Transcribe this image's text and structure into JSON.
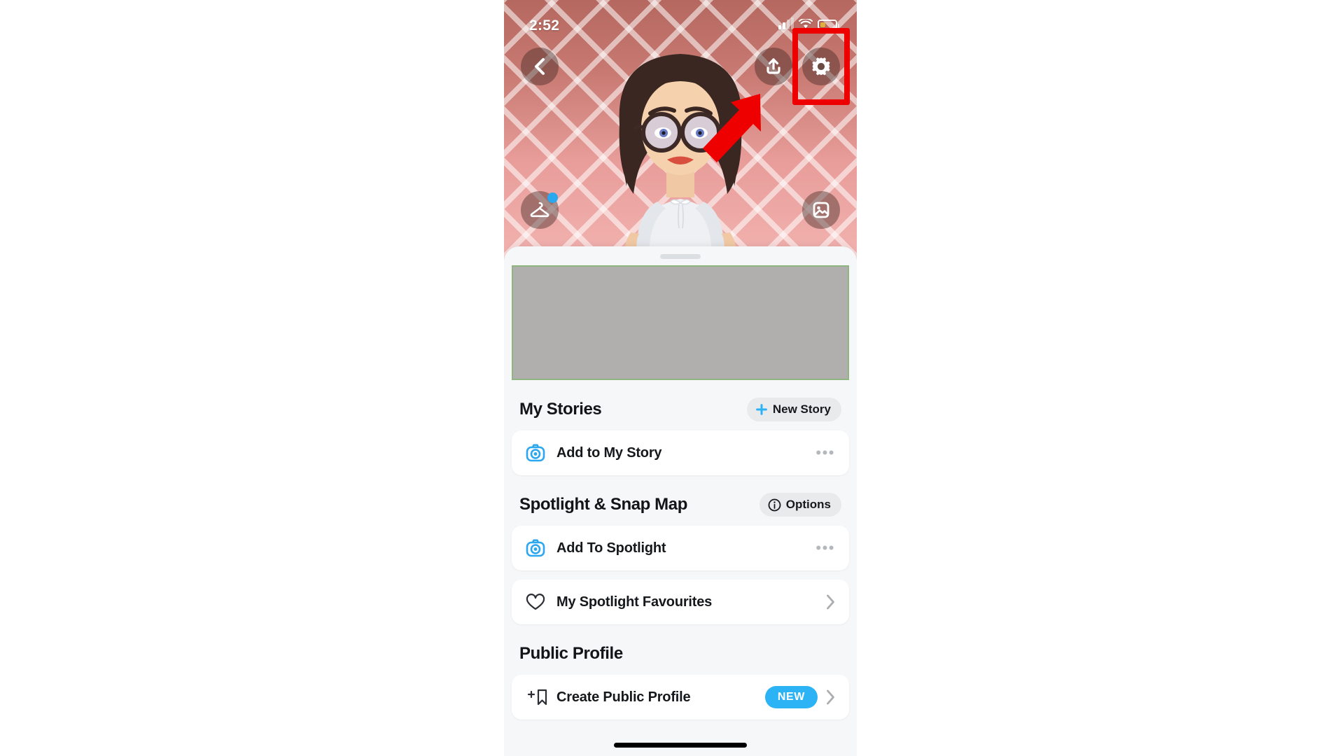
{
  "status_bar": {
    "time": "2:52",
    "signal_icon": "cellular-signal-icon",
    "wifi_icon": "wifi-icon",
    "battery_icon": "battery-icon"
  },
  "hero": {
    "back_icon": "chevron-left-icon",
    "share_icon": "share-upload-icon",
    "settings_icon": "gear-icon",
    "wardrobe_icon": "clothes-hanger-icon",
    "memories_icon": "photo-image-icon",
    "avatar_alt": "bitmoji-avatar",
    "annotation_box_color": "#ee0000",
    "annotation_arrow_color": "#ee0000",
    "badge_color": "#29a8f0",
    "background_color": "#c87a72"
  },
  "sheet": {
    "redacted_block": "",
    "sections": [
      {
        "title": "My Stories",
        "action": {
          "label": "New Story",
          "icon": "plus-icon"
        },
        "rows": [
          {
            "label": "Add to My Story",
            "icon": "camera-icon",
            "trailing": "more-options",
            "trailing_text": "•••"
          }
        ]
      },
      {
        "title": "Spotlight & Snap Map",
        "action": {
          "label": "Options",
          "icon": "info-circle-icon"
        },
        "rows": [
          {
            "label": "Add To Spotlight",
            "icon": "camera-icon",
            "trailing": "more-options",
            "trailing_text": "•••"
          },
          {
            "label": "My Spotlight Favourites",
            "icon": "heart-icon",
            "trailing": "chevron-right"
          }
        ]
      },
      {
        "title": "Public Profile",
        "action": null,
        "rows": [
          {
            "label": "Create Public Profile",
            "icon": "add-bookmark-icon",
            "trailing": "chevron-right",
            "badge": "NEW"
          }
        ]
      }
    ]
  },
  "colors": {
    "accent_blue": "#2cb3f5",
    "camera_icon_blue": "#2aa7ef",
    "sheet_bg": "#f6f7f8",
    "card_bg": "#ffffff",
    "text_primary": "#16191c"
  }
}
